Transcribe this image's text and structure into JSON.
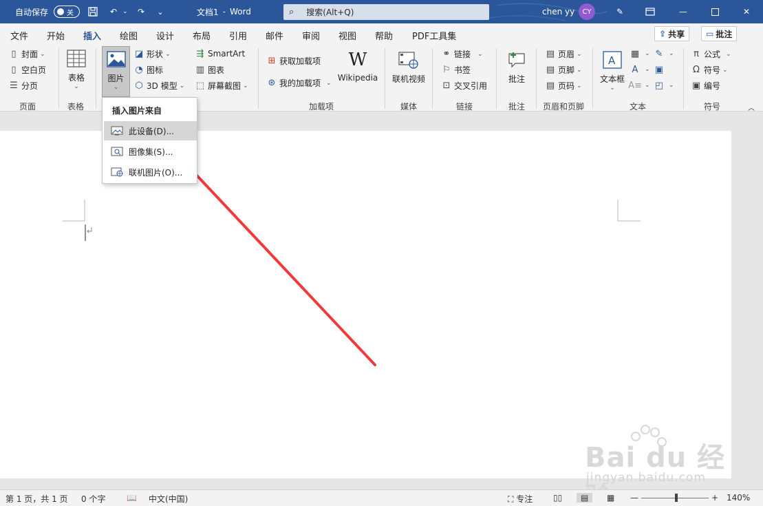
{
  "titlebar": {
    "autosave_label": "自动保存",
    "autosave_state": "关",
    "doc_title": "文档1",
    "app_sep": "-",
    "app_name": "Word",
    "search_placeholder": "搜索(Alt+Q)",
    "user_name": "chen yy",
    "user_initials": "CY"
  },
  "tabs": [
    "文件",
    "开始",
    "插入",
    "绘图",
    "设计",
    "布局",
    "引用",
    "邮件",
    "审阅",
    "视图",
    "帮助",
    "PDF工具集"
  ],
  "active_tab": "插入",
  "share_label": "共享",
  "comment_label": "批注",
  "ribbon": {
    "pages": {
      "cover": "封面",
      "blank": "空白页",
      "break": "分页",
      "label": "页面"
    },
    "tables": {
      "table": "表格",
      "label": "表格"
    },
    "illustrations": {
      "picture": "图片",
      "shapes": "形状",
      "icons": "图标",
      "model3d": "3D 模型",
      "smartart": "SmartArt",
      "chart": "图表",
      "screenshot": "屏幕截图"
    },
    "addins": {
      "get": "获取加载项",
      "mine": "我的加载项",
      "wikipedia": "Wikipedia",
      "label": "加载项"
    },
    "media": {
      "video": "联机视频",
      "label": "媒体"
    },
    "links": {
      "link": "链接",
      "bookmark": "书签",
      "crossref": "交叉引用",
      "label": "链接"
    },
    "comments": {
      "comment": "批注",
      "label": "批注"
    },
    "headerfooter": {
      "header": "页眉",
      "footer": "页脚",
      "pagenum": "页码",
      "label": "页眉和页脚"
    },
    "text": {
      "textbox": "文本框",
      "label": "文本"
    },
    "symbols": {
      "equation": "公式",
      "symbol": "符号",
      "number": "编号",
      "label": "符号"
    }
  },
  "dropdown": {
    "header": "插入图片来自",
    "items": [
      "此设备(D)...",
      "图像集(S)...",
      "联机图片(O)..."
    ]
  },
  "status": {
    "page": "第 1 页，共 1 页",
    "words": "0 个字",
    "lang": "中文(中国)",
    "focus": "专注",
    "zoom": "140%"
  },
  "watermark": {
    "logo": "Bai du 经验",
    "url": "jingyan.baidu.com"
  },
  "colors": {
    "accent": "#2b579a",
    "annotation_arrow": "#f0393b"
  }
}
